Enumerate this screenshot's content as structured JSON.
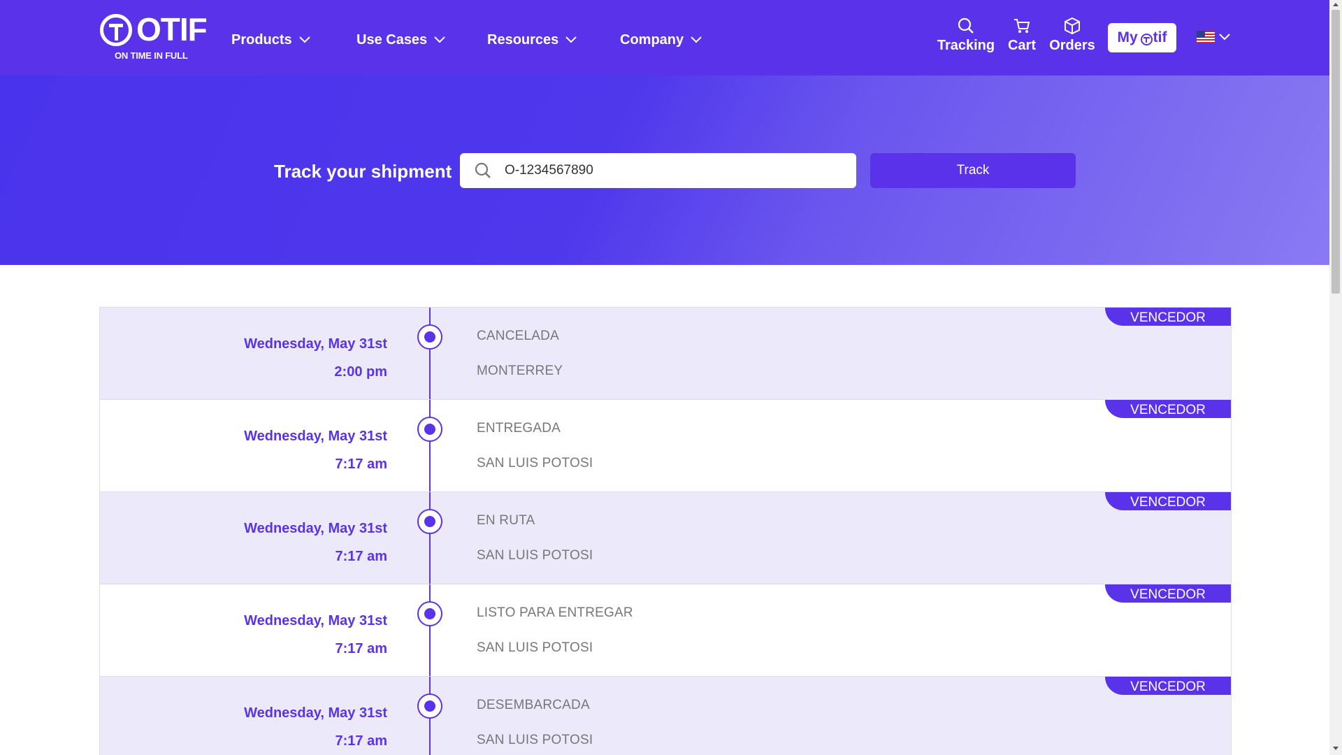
{
  "brand": {
    "name": "OTIF",
    "tagline": "ON TIME IN FULL"
  },
  "nav": {
    "menus": [
      {
        "label": "Products"
      },
      {
        "label": "Use Cases"
      },
      {
        "label": "Resources"
      },
      {
        "label": "Company"
      }
    ],
    "tracking_label": "Tracking",
    "cart_label": "Cart",
    "orders_label": "Orders",
    "account_prefix": "My",
    "account_suffix": "tif",
    "language_icon": "us-flag-icon"
  },
  "hero": {
    "title": "Track your shipment",
    "search_value": "O-1234567890",
    "track_button": "Track"
  },
  "events": [
    {
      "day": "Wednesday, May 31st",
      "time": "2:00 pm",
      "status": "CANCELADA",
      "city": "MONTERREY",
      "badge": "VENCEDOR"
    },
    {
      "day": "Wednesday, May 31st",
      "time": "7:17 am",
      "status": "ENTREGADA",
      "city": "SAN LUIS POTOSI",
      "badge": "VENCEDOR"
    },
    {
      "day": "Wednesday, May 31st",
      "time": "7:17 am",
      "status": "EN RUTA",
      "city": "SAN LUIS POTOSI",
      "badge": "VENCEDOR"
    },
    {
      "day": "Wednesday, May 31st",
      "time": "7:17 am",
      "status": "LISTO PARA ENTREGAR",
      "city": "SAN LUIS POTOSI",
      "badge": "VENCEDOR"
    },
    {
      "day": "Wednesday, May 31st",
      "time": "7:17 am",
      "status": "DESEMBARCADA",
      "city": "SAN LUIS POTOSI",
      "badge": "VENCEDOR"
    }
  ],
  "colors": {
    "brand_purple": "#5a32ea",
    "row_shade": "#ece9fb",
    "muted_text": "#777777"
  }
}
